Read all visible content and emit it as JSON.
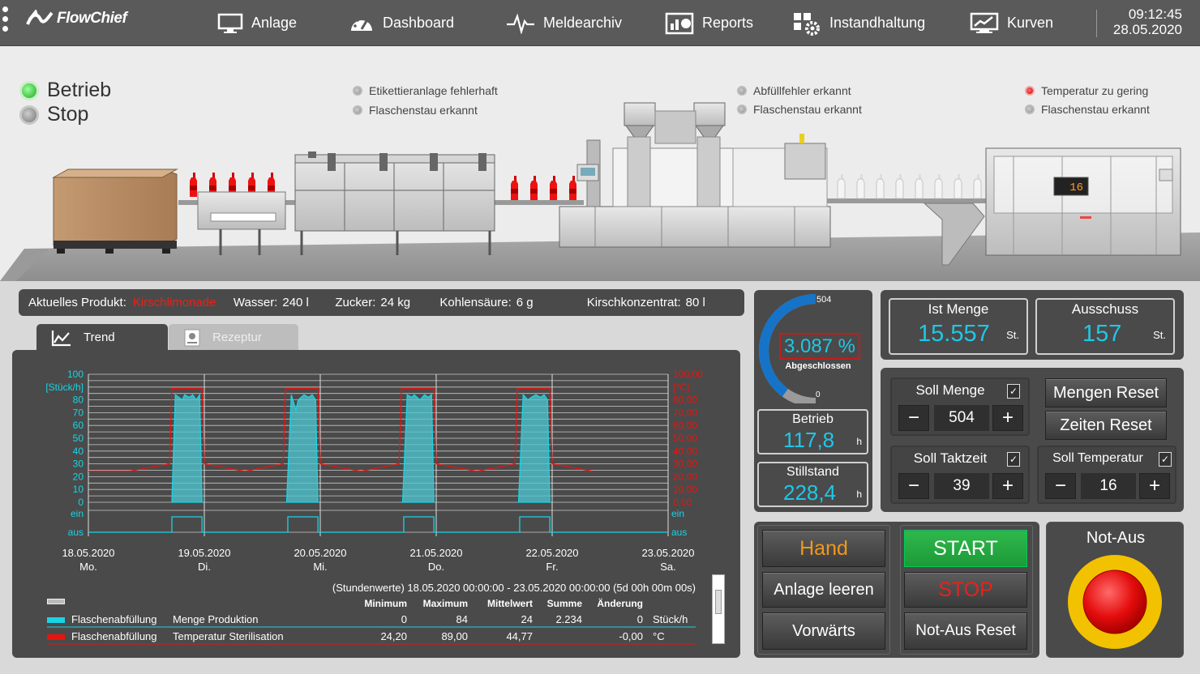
{
  "header": {
    "logo": "FlowChief",
    "nav": [
      {
        "label": "Anlage",
        "icon": "monitor-icon"
      },
      {
        "label": "Dashboard",
        "icon": "gauge-icon"
      },
      {
        "label": "Meldearchiv",
        "icon": "pulse-icon"
      },
      {
        "label": "Reports",
        "icon": "report-chart-icon"
      },
      {
        "label": "Instandhaltung",
        "icon": "maintenance-icon"
      },
      {
        "label": "Kurven",
        "icon": "trend-curve-icon"
      }
    ],
    "time": "09:12:45",
    "date": "28.05.2020"
  },
  "status": {
    "betrieb": "Betrieb",
    "stop": "Stop"
  },
  "alarms": {
    "group1": [
      "Etikettieranlage fehlerhaft",
      "Flaschenstau erkannt"
    ],
    "group2": [
      "Abfüllfehler erkannt",
      "Flaschenstau erkannt"
    ],
    "group3": [
      "Temperatur zu gering",
      "Flaschenstau erkannt"
    ]
  },
  "machine_display": "16",
  "product": {
    "label": "Aktuelles Produkt:",
    "value": "Kirschlimonade",
    "wasser_label": "Wasser:",
    "wasser": "240 l",
    "zucker_label": "Zucker:",
    "zucker": "24 kg",
    "kohlen_label": "Kohlensäure:",
    "kohlen": "6 g",
    "kirsch_label": "Kirschkonzentrat:",
    "kirsch": "80 l"
  },
  "tabs": {
    "trend": "Trend",
    "rezeptur": "Rezeptur"
  },
  "chart_data": {
    "type": "area",
    "ylabel_left": "[Stück/h]",
    "ylabel_right": "[°C]",
    "left_ticks": [
      "100",
      "80",
      "70",
      "60",
      "50",
      "40",
      "30",
      "20",
      "10",
      "0"
    ],
    "right_ticks": [
      "100,00",
      "80,00",
      "70,00",
      "60,00",
      "50,00",
      "40,00",
      "30,00",
      "20,00",
      "10,00",
      "0,00"
    ],
    "bool_labels": [
      "ein",
      "aus"
    ],
    "x_dates": [
      "18.05.2020",
      "19.05.2020",
      "20.05.2020",
      "21.05.2020",
      "22.05.2020",
      "23.05.2020"
    ],
    "x_days": [
      "Mo.",
      "Di.",
      "Mi.",
      "Do.",
      "Fr.",
      "Sa."
    ],
    "ylim_left": [
      0,
      100
    ],
    "ylim_right": [
      0,
      100
    ],
    "series": [
      {
        "name": "Flaschenabfüllung Menge Produktion",
        "color": "#19d3e6",
        "x": [
          18.72,
          18.75,
          18.81,
          18.83,
          18.87,
          18.9,
          18.93,
          18.96,
          18.98,
          19.71,
          19.75,
          19.79,
          19.81,
          19.86,
          19.9,
          19.93,
          19.96,
          19.98,
          20.71,
          20.75,
          20.79,
          20.81,
          20.86,
          20.9,
          20.93,
          20.96,
          20.98,
          21.71,
          21.75,
          21.79,
          21.82,
          21.86,
          21.9,
          21.93,
          21.96,
          21.98
        ],
        "y": [
          0,
          84,
          80,
          84,
          82,
          84,
          80,
          84,
          0,
          0,
          84,
          72,
          80,
          84,
          82,
          84,
          80,
          0,
          0,
          84,
          82,
          84,
          80,
          84,
          82,
          84,
          0,
          0,
          84,
          80,
          82,
          84,
          82,
          84,
          80,
          0
        ]
      },
      {
        "name": "Flaschenabfüllung Temperatur Sterilisation",
        "color": "#e8140f",
        "x": [
          18.0,
          18.35,
          18.7,
          18.72,
          18.98,
          19.0,
          19.35,
          19.68,
          19.7,
          19.98,
          20.0,
          20.35,
          20.68,
          20.7,
          20.98,
          21.0,
          21.35,
          21.68,
          21.7,
          21.98,
          22.0,
          22.35
        ],
        "y": [
          24.2,
          24.2,
          30,
          89,
          89,
          30,
          24.2,
          30,
          89,
          89,
          30,
          24.2,
          30,
          89,
          89,
          30,
          24.2,
          30,
          89,
          89,
          30,
          24.2
        ]
      },
      {
        "name": "Ein/Aus",
        "color": "#19d3e6",
        "x": [
          18.0,
          18.72,
          18.98,
          19.72,
          19.98,
          20.72,
          20.98,
          21.72,
          21.98,
          22.0
        ],
        "y": [
          0,
          1,
          0,
          1,
          0,
          1,
          0,
          1,
          0,
          0
        ]
      }
    ]
  },
  "legend": {
    "period": "(Stundenwerte) 18.05.2020 00:00:00 - 23.05.2020 00:00:00 (5d 00h 00m 00s)",
    "headers": [
      "Minimum",
      "Maximum",
      "Mittelwert",
      "Summe",
      "Änderung"
    ],
    "rows": [
      {
        "name": "Flaschenabfüllung",
        "desc": "Menge Produktion",
        "min": "0",
        "max": "84",
        "avg": "24",
        "sum": "2.234",
        "chg": "0",
        "unit": "Stück/h",
        "color": "#19d3e6"
      },
      {
        "name": "Flaschenabfüllung",
        "desc": "Temperatur Sterilisation",
        "min": "24,20",
        "max": "89,00",
        "avg": "44,77",
        "sum": "",
        "chg": "-0,00",
        "unit": "°C",
        "color": "#e8140f"
      }
    ]
  },
  "gauge": {
    "max": "504",
    "min": "0",
    "percent": "3.087 %",
    "label": "Abgeschlossen",
    "fill": 0.8
  },
  "betrieb": {
    "label": "Betrieb",
    "value": "117,8",
    "unit": "h"
  },
  "stillstand": {
    "label": "Stillstand",
    "value": "228,4",
    "unit": "h"
  },
  "ist_menge": {
    "label": "Ist Menge",
    "value": "15.557",
    "unit": "St."
  },
  "ausschuss": {
    "label": "Ausschuss",
    "value": "157",
    "unit": "St."
  },
  "soll_menge": {
    "label": "Soll Menge",
    "value": "504"
  },
  "soll_taktzeit": {
    "label": "Soll Taktzeit",
    "value": "39"
  },
  "soll_temperatur": {
    "label": "Soll Temperatur",
    "value": "16"
  },
  "buttons": {
    "mengen_reset": "Mengen Reset",
    "zeiten_reset": "Zeiten Reset",
    "hand": "Hand",
    "anlage_leeren": "Anlage leeren",
    "vorwaerts": "Vorwärts",
    "start": "START",
    "stop": "STOP",
    "notaus_reset": "Not-Aus Reset",
    "notaus": "Not-Aus",
    "minus": "−",
    "plus": "+",
    "check": "✓"
  }
}
